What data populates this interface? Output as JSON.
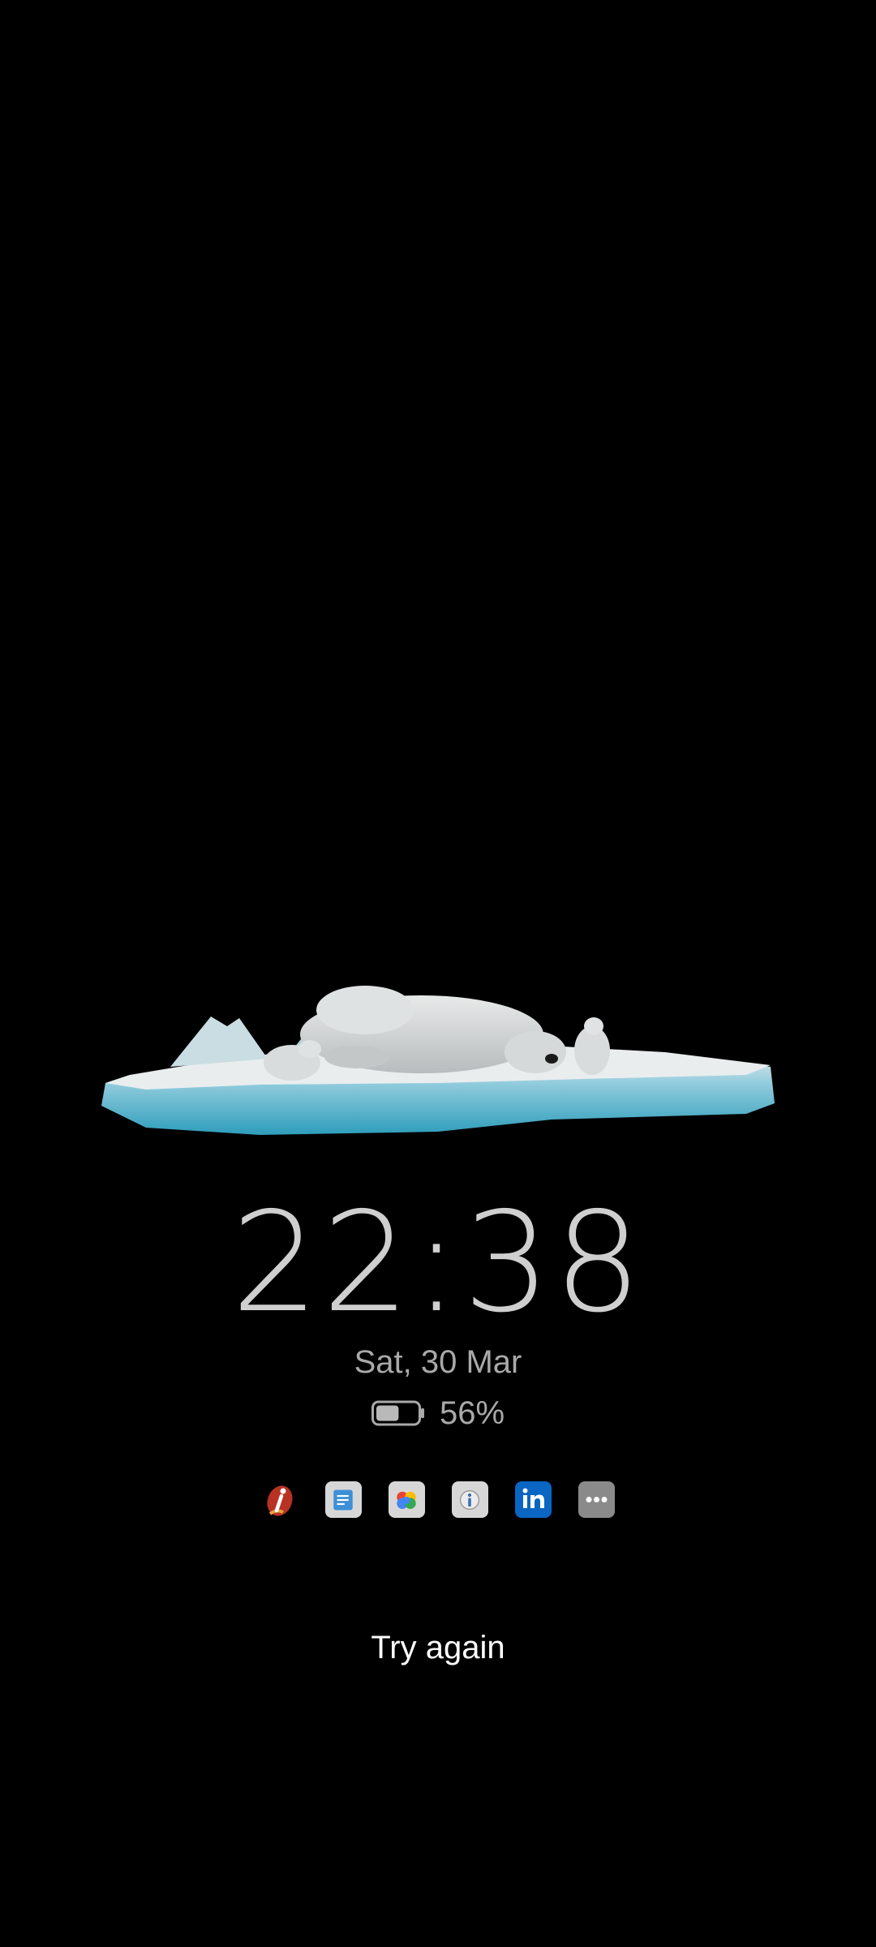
{
  "lock_screen": {
    "time": "22:38",
    "date": "Sat, 30 Mar",
    "battery": {
      "percent_text": "56%",
      "level": 0.56,
      "icon": "battery-icon"
    },
    "notification_icons": [
      {
        "name": "icici-app-icon",
        "color": "#b83224"
      },
      {
        "name": "docs-app-icon",
        "color": "#3d8fd6"
      },
      {
        "name": "google-pay-app-icon",
        "color": "#4285f4"
      },
      {
        "name": "info-app-icon",
        "color": "#3a6fb5"
      },
      {
        "name": "linkedin-app-icon",
        "color": "#0a66c2"
      },
      {
        "name": "more-notifications-icon",
        "color": "#8a8a8a"
      }
    ],
    "unlock_prompt": "Try again"
  },
  "wallpaper": {
    "subject": "polar-bears-on-ice-floe",
    "ice_color": "#5fb8d0",
    "snow_color": "#e4e8ea"
  }
}
